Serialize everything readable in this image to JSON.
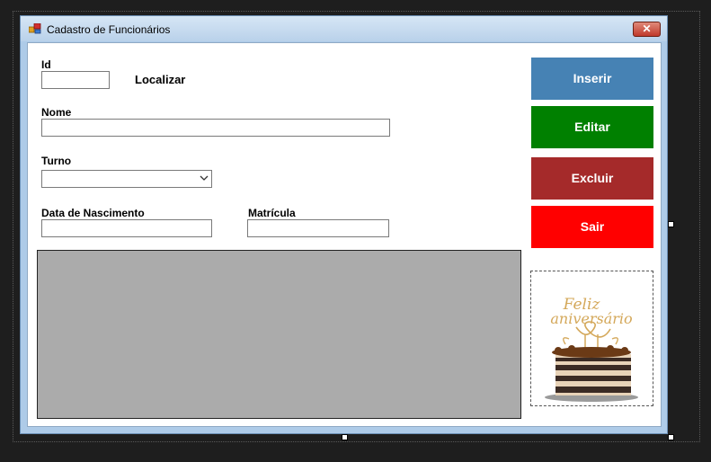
{
  "window": {
    "title": "Cadastro de Funcionários",
    "close_glyph": "✕",
    "icon": "form-app-icon"
  },
  "fields": {
    "id_label": "Id",
    "id_value": "",
    "find_label": "Localizar",
    "name_label": "Nome",
    "name_value": "",
    "shift_label": "Turno",
    "shift_value": "",
    "birth_label": "Data de Nascimento",
    "birth_value": "",
    "registration_label": "Matrícula",
    "registration_value": ""
  },
  "buttons": {
    "insert": "Inserir",
    "edit": "Editar",
    "delete": "Excluir",
    "exit": "Sair"
  },
  "colors": {
    "insert": "#4682b4",
    "edit": "#008000",
    "delete": "#a52a2a",
    "exit": "#ff0000",
    "grid": "#ababab"
  },
  "picture": {
    "caption_line1": "Feliz",
    "caption_line2": "aniversário"
  }
}
